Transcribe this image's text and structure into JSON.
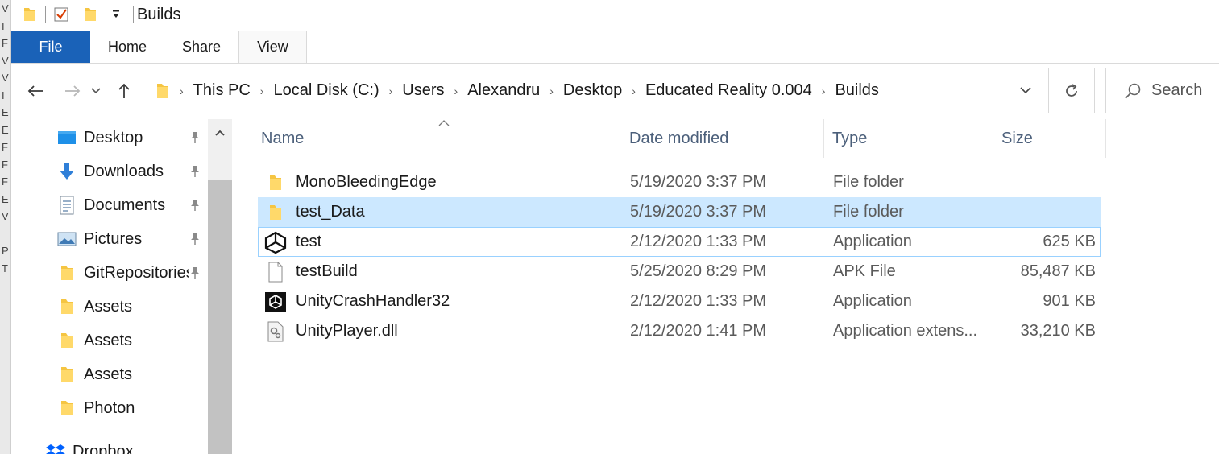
{
  "window": {
    "title": "Builds",
    "background_strip": [
      "V",
      "I",
      "F",
      "V",
      "V",
      "I",
      "E",
      "E",
      "F",
      "F",
      "F",
      "E",
      "V",
      "",
      "P",
      "T"
    ]
  },
  "ribbon": {
    "tabs": [
      "File",
      "Home",
      "Share",
      "View"
    ],
    "active_tab": "File",
    "accent_color": "#1a62b8"
  },
  "address": {
    "crumbs": [
      "This PC",
      "Local Disk (C:)",
      "Users",
      "Alexandru",
      "Desktop",
      "Educated Reality 0.004",
      "Builds"
    ],
    "search_placeholder": "Search"
  },
  "nav_pane": {
    "items": [
      {
        "label": "Desktop",
        "icon": "desktop-icon",
        "pinned": true
      },
      {
        "label": "Downloads",
        "icon": "downloads-icon",
        "pinned": true
      },
      {
        "label": "Documents",
        "icon": "documents-icon",
        "pinned": true
      },
      {
        "label": "Pictures",
        "icon": "pictures-icon",
        "pinned": true
      },
      {
        "label": "GitRepositories",
        "icon": "folder-icon",
        "pinned": true
      },
      {
        "label": "Assets",
        "icon": "folder-icon",
        "pinned": false
      },
      {
        "label": "Assets",
        "icon": "folder-icon",
        "pinned": false
      },
      {
        "label": "Assets",
        "icon": "folder-icon",
        "pinned": false
      },
      {
        "label": "Photon",
        "icon": "folder-icon",
        "pinned": false
      },
      {
        "label": "Dropbox",
        "icon": "dropbox-icon",
        "pinned": false
      }
    ]
  },
  "file_list": {
    "columns": {
      "name": "Name",
      "date": "Date modified",
      "type": "Type",
      "size": "Size"
    },
    "rows": [
      {
        "name": "MonoBleedingEdge",
        "date": "5/19/2020 3:37 PM",
        "type": "File folder",
        "size": "",
        "icon": "folder-icon",
        "state": ""
      },
      {
        "name": "test_Data",
        "date": "5/19/2020 3:37 PM",
        "type": "File folder",
        "size": "",
        "icon": "folder-icon",
        "state": "selected"
      },
      {
        "name": "test",
        "date": "2/12/2020 1:33 PM",
        "type": "Application",
        "size": "625 KB",
        "icon": "unity-icon",
        "state": "hover"
      },
      {
        "name": "testBuild",
        "date": "5/25/2020 8:29 PM",
        "type": "APK File",
        "size": "85,487 KB",
        "icon": "blank-file-icon",
        "state": ""
      },
      {
        "name": "UnityCrashHandler32",
        "date": "2/12/2020 1:33 PM",
        "type": "Application",
        "size": "901 KB",
        "icon": "unity-crash-icon",
        "state": ""
      },
      {
        "name": "UnityPlayer.dll",
        "date": "2/12/2020 1:41 PM",
        "type": "Application extens...",
        "size": "33,210 KB",
        "icon": "dll-file-icon",
        "state": ""
      }
    ]
  }
}
